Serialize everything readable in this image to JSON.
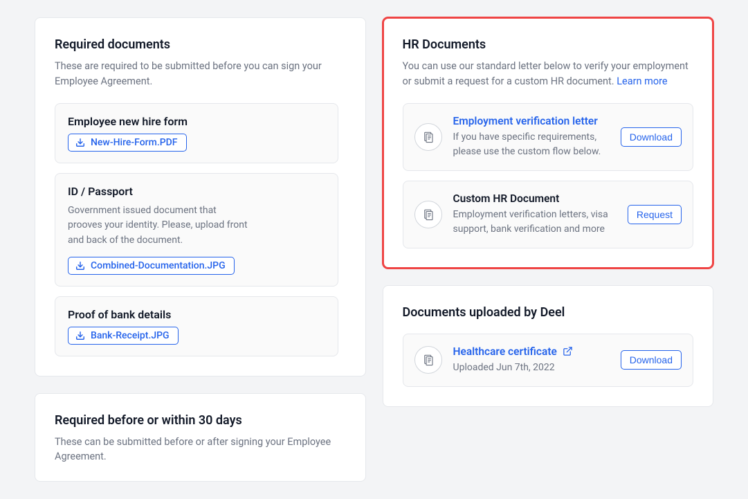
{
  "required": {
    "title": "Required documents",
    "desc": "These are required to be submitted before you can sign your Employee Agreement.",
    "items": [
      {
        "title": "Employee new hire form",
        "file": "New-Hire-Form.PDF"
      },
      {
        "title": "ID / Passport",
        "desc": "Government issued document that prooves your identity. Please, upload front and back of the document.",
        "file": "Combined-Documentation.JPG"
      },
      {
        "title": "Proof of bank details",
        "file": "Bank-Receipt.JPG"
      }
    ]
  },
  "required30": {
    "title": "Required before or within 30 days",
    "desc": "These can be submitted before or after signing your Employee Agreement."
  },
  "hr": {
    "title": "HR Documents",
    "desc_pre": "You can use our standard letter below to verify your employment or submit a request for a custom HR document. ",
    "learn_more": "Learn more",
    "items": [
      {
        "title": "Employment verification letter",
        "desc": "If you have specific requirements, please use the custom flow below.",
        "button": "Download"
      },
      {
        "title": "Custom HR Document",
        "desc": "Employment verification letters, visa support, bank verification and more",
        "button": "Request"
      }
    ]
  },
  "uploaded": {
    "title": "Documents uploaded by Deel",
    "items": [
      {
        "title": "Healthcare certificate",
        "desc": "Uploaded Jun 7th, 2022",
        "button": "Download"
      }
    ]
  }
}
